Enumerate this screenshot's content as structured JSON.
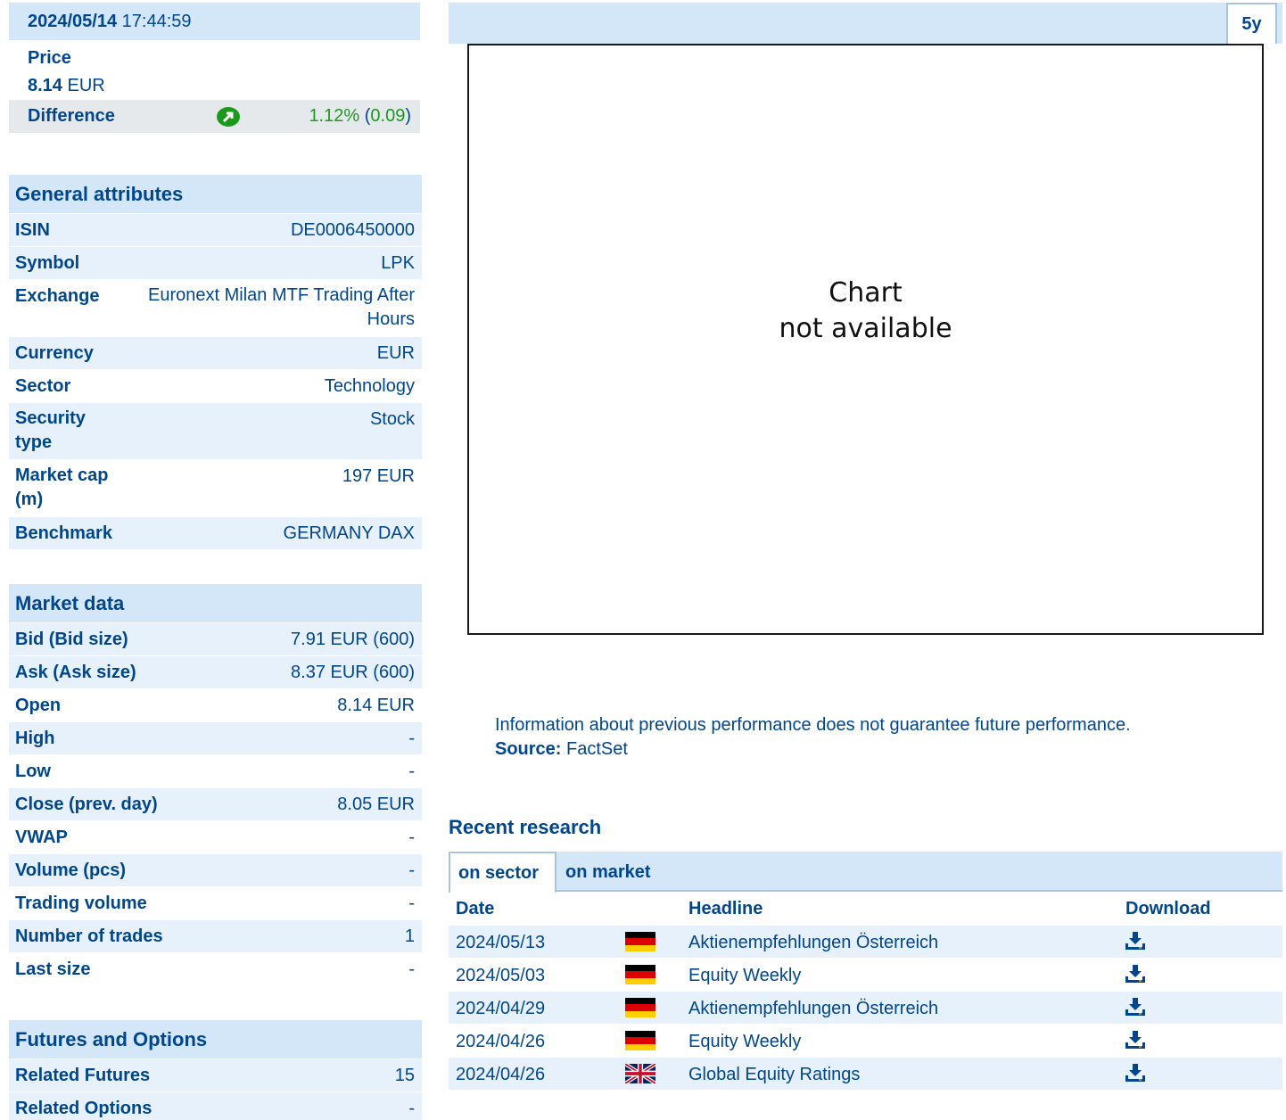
{
  "quote": {
    "date": "2024/05/14",
    "time": "17:44:59",
    "price_label": "Price",
    "price_value": "8.14",
    "price_currency": "EUR",
    "difference_label": "Difference",
    "difference_pct": "1.12%",
    "difference_abs": "0.09",
    "difference_direction": "up",
    "up_color": "#1a9a1a"
  },
  "general": {
    "title": "General attributes",
    "rows": [
      {
        "label": "ISIN",
        "value": "DE0006450000"
      },
      {
        "label": "Symbol",
        "value": "LPK"
      },
      {
        "label": "Exchange",
        "value": "Euronext Milan MTF Trading After Hours"
      },
      {
        "label": "Currency",
        "value": "EUR"
      },
      {
        "label": "Sector",
        "value": "Technology"
      },
      {
        "label": "Security type",
        "value": "Stock"
      },
      {
        "label": "Market cap (m)",
        "value": "197 EUR"
      },
      {
        "label": "Benchmark",
        "value": "GERMANY DAX"
      }
    ]
  },
  "market": {
    "title": "Market data",
    "rows": [
      {
        "label": "Bid (Bid size)",
        "value": "7.91 EUR (600)"
      },
      {
        "label": "Ask (Ask size)",
        "value": "8.37 EUR (600)"
      },
      {
        "label": "Open",
        "value": "8.14 EUR"
      },
      {
        "label": "High",
        "value": "-"
      },
      {
        "label": "Low",
        "value": "-"
      },
      {
        "label": "Close (prev. day)",
        "value": "8.05 EUR"
      },
      {
        "label": "VWAP",
        "value": "-"
      },
      {
        "label": "Volume (pcs)",
        "value": "-"
      },
      {
        "label": "Trading volume",
        "value": "-"
      },
      {
        "label": "Number of trades",
        "value": "1"
      },
      {
        "label": "Last size",
        "value": "-"
      }
    ]
  },
  "futures": {
    "title": "Futures and Options",
    "rows": [
      {
        "label": "Related Futures",
        "value": "15"
      },
      {
        "label": "Related Options",
        "value": "-"
      }
    ]
  },
  "chart": {
    "range_tab": "5y",
    "message_line1": "Chart",
    "message_line2": "not available"
  },
  "disclaimer": {
    "text": "Information about previous performance does not guarantee future performance.",
    "source_label": "Source:",
    "source_value": "FactSet"
  },
  "research": {
    "title": "Recent research",
    "tabs": [
      "on sector",
      "on market"
    ],
    "active_tab": "on sector",
    "columns": [
      "Date",
      "Headline",
      "Download"
    ],
    "rows": [
      {
        "date": "2024/05/13",
        "flag": "de",
        "headline": "Aktienempfehlungen Österreich",
        "download_icon": "download-icon"
      },
      {
        "date": "2024/05/03",
        "flag": "de",
        "headline": "Equity Weekly",
        "download_icon": "download-icon"
      },
      {
        "date": "2024/04/29",
        "flag": "de",
        "headline": "Aktienempfehlungen Österreich",
        "download_icon": "download-icon"
      },
      {
        "date": "2024/04/26",
        "flag": "de",
        "headline": "Equity Weekly",
        "download_icon": "download-icon"
      },
      {
        "date": "2024/04/26",
        "flag": "gb",
        "headline": "Global Equity Ratings",
        "download_icon": "download-icon"
      }
    ]
  }
}
